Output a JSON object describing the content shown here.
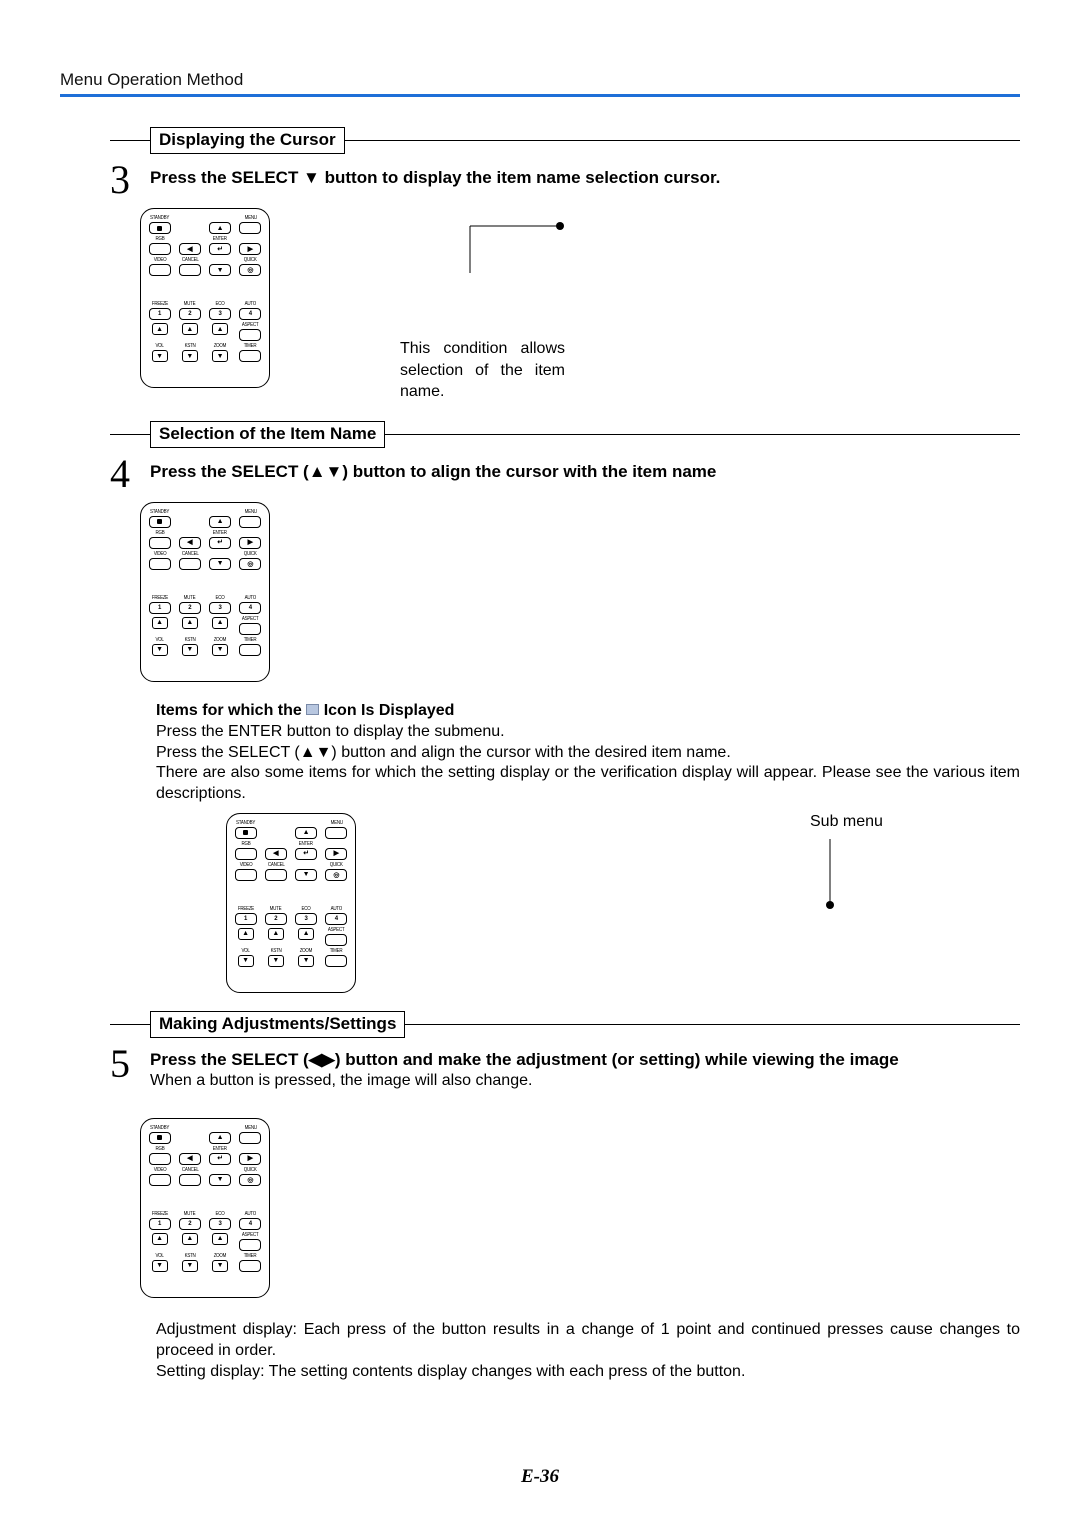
{
  "header": {
    "title": "Menu Operation Method"
  },
  "sections": {
    "s1": {
      "title": "Displaying the Cursor"
    },
    "s2": {
      "title": "Selection of the Item Name"
    },
    "s3": {
      "title": "Making Adjustments/Settings"
    }
  },
  "steps": {
    "step3": {
      "num": "3",
      "text": "Press the SELECT ▼ button to display the item name selection cursor.",
      "callout": "This condition allows selection of the item name."
    },
    "step4": {
      "num": "4",
      "text": "Press the SELECT (▲▼) button to align the cursor with the item name",
      "sub_heading_pre": "Items for which the ",
      "sub_heading_post": " Icon Is Displayed",
      "p1": "Press the ENTER button to display the submenu.",
      "p2": "Press the SELECT (▲▼) button and align the cursor with the desired item name.",
      "p3": "There are also some items for which the setting display or the verification display will appear. Please see the various item descriptions.",
      "submenu_label": "Sub menu"
    },
    "step5": {
      "num": "5",
      "text": "Press the SELECT (◀▶) button and make the adjustment (or setting) while viewing the image",
      "subtext": "When a button is pressed, the image will also change.",
      "p_adj": "Adjustment display: Each press of the button results in a change of 1 point and continued presses cause changes to proceed in order.",
      "p_set": "Setting display: The setting contents display changes with each press of the button."
    }
  },
  "remote": {
    "labels": {
      "standby": "STANDBY",
      "menu": "MENU",
      "rgb": "RGB",
      "enter": "ENTER",
      "video": "VIDEO",
      "cancel": "CANCEL",
      "quick": "QUICK",
      "freeze": "FREEZE",
      "mute": "MUTE",
      "eco": "ECO",
      "auto": "AUTO",
      "aspect": "ASPECT",
      "vol": "VOL",
      "kstn": "KSTN",
      "zoom": "ZOOM",
      "timer": "TIMER"
    },
    "digits": {
      "d1": "1",
      "d2": "2",
      "d3": "3",
      "d4": "4"
    },
    "glyphs": {
      "up": "▲",
      "down": "▼",
      "left": "◀",
      "right": "▶",
      "enter": "↵",
      "q": "◎"
    }
  },
  "footer": {
    "page": "E-36"
  }
}
